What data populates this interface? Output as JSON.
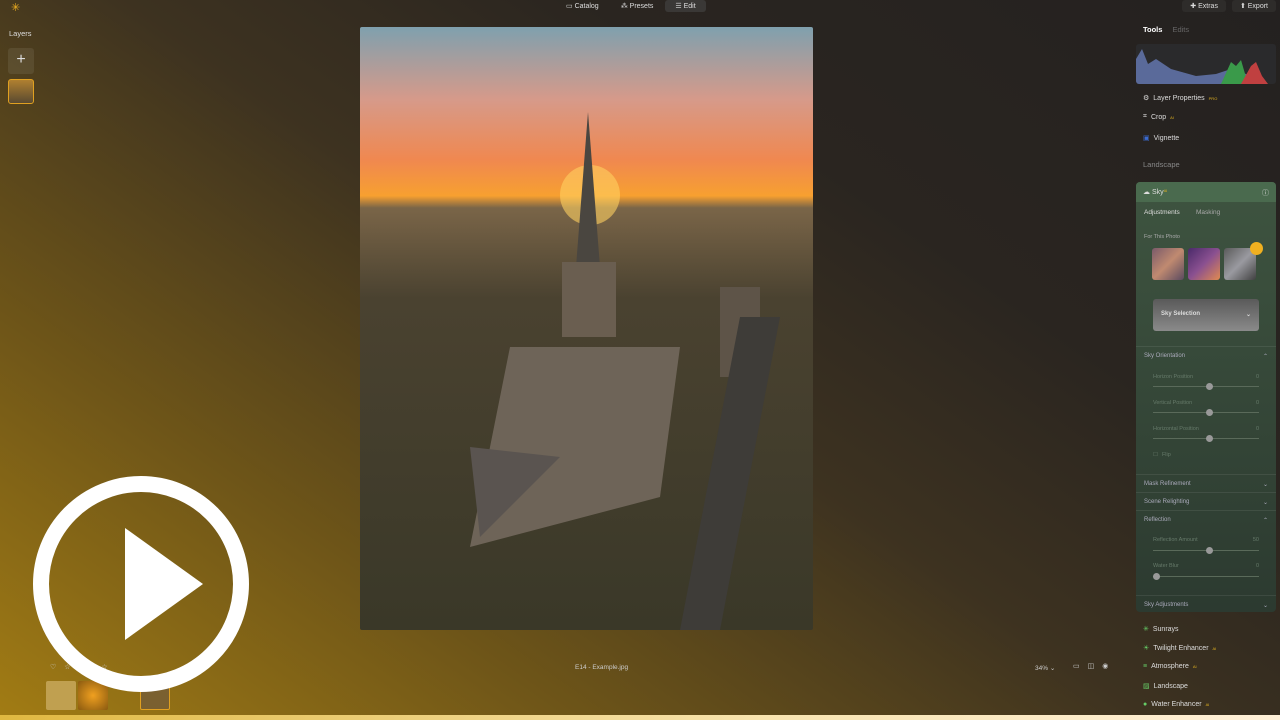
{
  "topbar": {
    "nav": [
      "Catalog",
      "Presets",
      "Edit"
    ],
    "active": "Edit",
    "extras": "Extras",
    "export": "Export"
  },
  "layers": {
    "title": "Layers",
    "add": "+"
  },
  "panel": {
    "tabs": [
      "Tools",
      "Edits"
    ],
    "tools": [
      {
        "label": "Layer Properties",
        "badge": "PRO"
      },
      {
        "label": "Crop",
        "badge": "AI"
      },
      {
        "label": "Vignette",
        "badge": ""
      }
    ],
    "section": "Landscape",
    "sky": {
      "title": "Sky",
      "badge": "AI",
      "subtabs": [
        "Adjustments",
        "Masking"
      ],
      "for_photo": "For This Photo",
      "selection": "Sky Selection",
      "orientation": "Sky Orientation",
      "sliders": [
        {
          "label": "Horizon Position",
          "value": "0",
          "pos": 0.5
        },
        {
          "label": "Vertical Position",
          "value": "0",
          "pos": 0.5
        },
        {
          "label": "Horizontal Position",
          "value": "0",
          "pos": 0.5
        }
      ],
      "flip": "Flip",
      "mask": "Mask Refinement",
      "relight": "Scene Relighting",
      "reflection": "Reflection",
      "refl_sliders": [
        {
          "label": "Reflection Amount",
          "value": "50",
          "pos": 0.5
        },
        {
          "label": "Water Blur",
          "value": "0",
          "pos": 0
        }
      ],
      "adjust": "Sky Adjustments"
    },
    "more": [
      {
        "label": "Sunrays",
        "badge": ""
      },
      {
        "label": "Twilight Enhancer",
        "badge": "AI"
      },
      {
        "label": "Atmosphere",
        "badge": "AI"
      },
      {
        "label": "Landscape",
        "badge": ""
      },
      {
        "label": "Water Enhancer",
        "badge": "AI"
      }
    ]
  },
  "bottom": {
    "filename": "E14 - Example.jpg",
    "zoom": "34%",
    "rating": 0
  }
}
